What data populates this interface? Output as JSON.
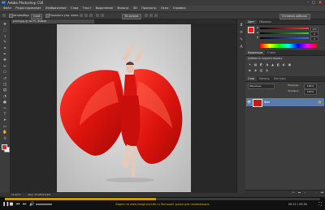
{
  "app": {
    "title": "Adobe Photoshop CS6",
    "logo_text": "Ps",
    "window_buttons": [
      "–",
      "□",
      "×"
    ]
  },
  "menu": {
    "items": [
      "Файл",
      "Редактирование",
      "Изображение",
      "Слои",
      "Текст",
      "Выделение",
      "Фильтр",
      "3D",
      "Просмотр",
      "Окно",
      "Справка"
    ]
  },
  "options": {
    "auto_select_label": "Автовыбор:",
    "auto_select_value": "Слой",
    "show_transform_label": "Показать упр. элем.",
    "mode_button": "3D-режим:",
    "workspace_select": "Основная рабочая среда"
  },
  "document": {
    "tab_label": "photo.jpg @ 16,7% (RGB/8)"
  },
  "tools": [
    {
      "name": "move-tool",
      "glyph": "✥"
    },
    {
      "name": "marquee-tool",
      "glyph": "⬚"
    },
    {
      "name": "lasso-tool",
      "glyph": "ↄ"
    },
    {
      "name": "quick-select-tool",
      "glyph": "✎"
    },
    {
      "name": "crop-tool",
      "glyph": "⌗"
    },
    {
      "name": "eyedropper-tool",
      "glyph": "✒"
    },
    {
      "name": "healing-tool",
      "glyph": "✚"
    },
    {
      "name": "brush-tool",
      "glyph": "✏"
    },
    {
      "name": "clone-stamp-tool",
      "glyph": "⎔"
    },
    {
      "name": "history-brush-tool",
      "glyph": "↺"
    },
    {
      "name": "eraser-tool",
      "glyph": "◫"
    },
    {
      "name": "gradient-tool",
      "glyph": "▤"
    },
    {
      "name": "blur-tool",
      "glyph": "◔"
    },
    {
      "name": "dodge-tool",
      "glyph": "●"
    },
    {
      "name": "pen-tool",
      "glyph": "✑"
    },
    {
      "name": "type-tool",
      "glyph": "T"
    },
    {
      "name": "path-select-tool",
      "glyph": "➤"
    },
    {
      "name": "shape-tool",
      "glyph": "▭"
    },
    {
      "name": "hand-tool",
      "glyph": "✋"
    },
    {
      "name": "zoom-tool",
      "glyph": "⚲"
    }
  ],
  "panels": {
    "color_tabs": [
      "Цвет",
      "Образцы"
    ],
    "color_channels": [
      {
        "label": "R",
        "value": "255",
        "color": "#ff3b3b"
      },
      {
        "label": "G",
        "value": "0",
        "color": "#3bd13b"
      },
      {
        "label": "B",
        "value": "0",
        "color": "#3b6bff"
      }
    ],
    "adjust_tabs": [
      "Коррекция",
      "Стили"
    ],
    "adjust_hint": "Добавить корректировку",
    "layers_tabs": [
      "Слои",
      "Каналы",
      "Контуры"
    ],
    "blend_mode": "Обычные",
    "opacity_label": "Непрозр.:",
    "opacity_value": "100%",
    "fill_label": "Заливка:",
    "fill_value": "100%",
    "layer_name": "Фон"
  },
  "status": {
    "zoom": "16,67%",
    "doc_info": "Док: 24,9M/24,9M"
  },
  "player": {
    "caption": "Видео на www.imaginarysite.ru Фотошоп уроки для начинающих",
    "time": "00:12 / 05:34",
    "progress": 0.48,
    "accent_color": "#c79a00"
  }
}
